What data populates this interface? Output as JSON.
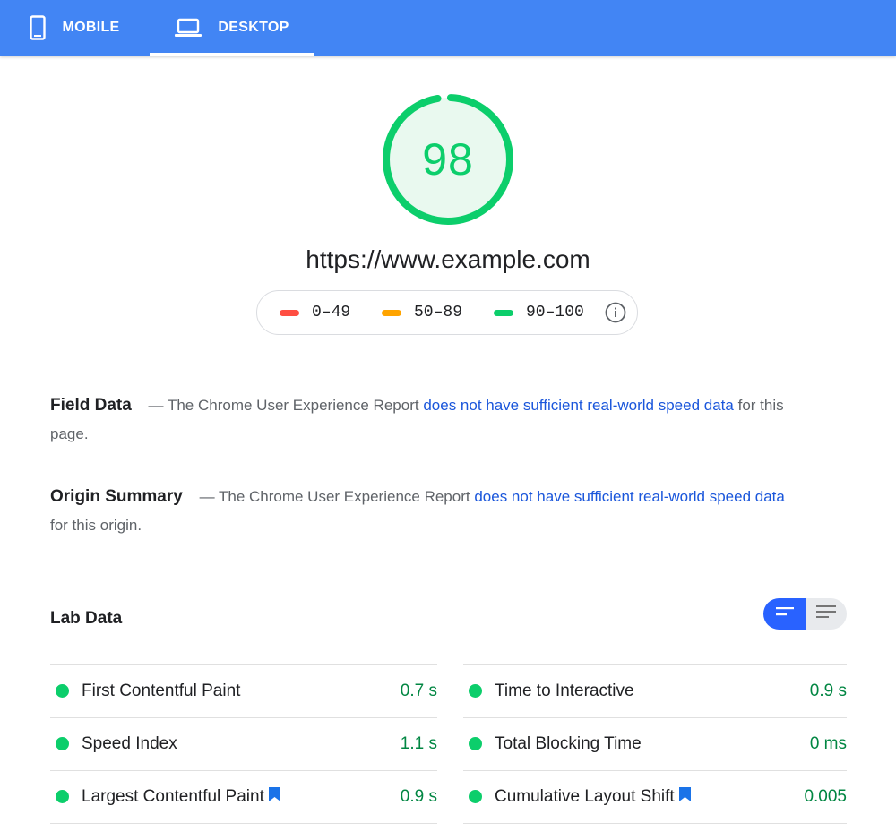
{
  "tabs": [
    {
      "label": "MOBILE",
      "icon": "phone-icon",
      "active": false
    },
    {
      "label": "DESKTOP",
      "icon": "laptop-icon",
      "active": true
    }
  ],
  "score": {
    "value": "98",
    "fraction": 0.98,
    "color": "#0cce6b"
  },
  "url": "https://www.example.com",
  "legend": {
    "items": [
      {
        "range": "0–49",
        "color": "#ff4e42"
      },
      {
        "range": "50–89",
        "color": "#ffa400"
      },
      {
        "range": "90–100",
        "color": "#0cce6b"
      }
    ],
    "info_icon": "info-icon"
  },
  "field_data": {
    "title": "Field Data",
    "dash": "—",
    "text_before": "The Chrome User Experience Report",
    "link": "does not have sufficient real-world speed data",
    "text_after": "for this page."
  },
  "origin_summary": {
    "title": "Origin Summary",
    "dash": "—",
    "text_before": "The Chrome User Experience Report",
    "link": "does not have sufficient real-world speed data",
    "text_after": "for this origin."
  },
  "lab_data": {
    "title": "Lab Data",
    "toggle": {
      "options": [
        "expanded-view-icon",
        "list-view-icon"
      ],
      "active": 0,
      "active_color": "#2962ff"
    },
    "metrics_left": [
      {
        "name": "First Contentful Paint",
        "value": "0.7 s",
        "bookmark": false
      },
      {
        "name": "Speed Index",
        "value": "1.1 s",
        "bookmark": false
      },
      {
        "name": "Largest Contentful Paint",
        "value": "0.9 s",
        "bookmark": true
      }
    ],
    "metrics_right": [
      {
        "name": "Time to Interactive",
        "value": "0.9 s",
        "bookmark": false
      },
      {
        "name": "Total Blocking Time",
        "value": "0 ms",
        "bookmark": false
      },
      {
        "name": "Cumulative Layout Shift",
        "value": "0.005",
        "bookmark": true
      }
    ],
    "status_color": "#0cce6b",
    "value_color": "#018642"
  }
}
